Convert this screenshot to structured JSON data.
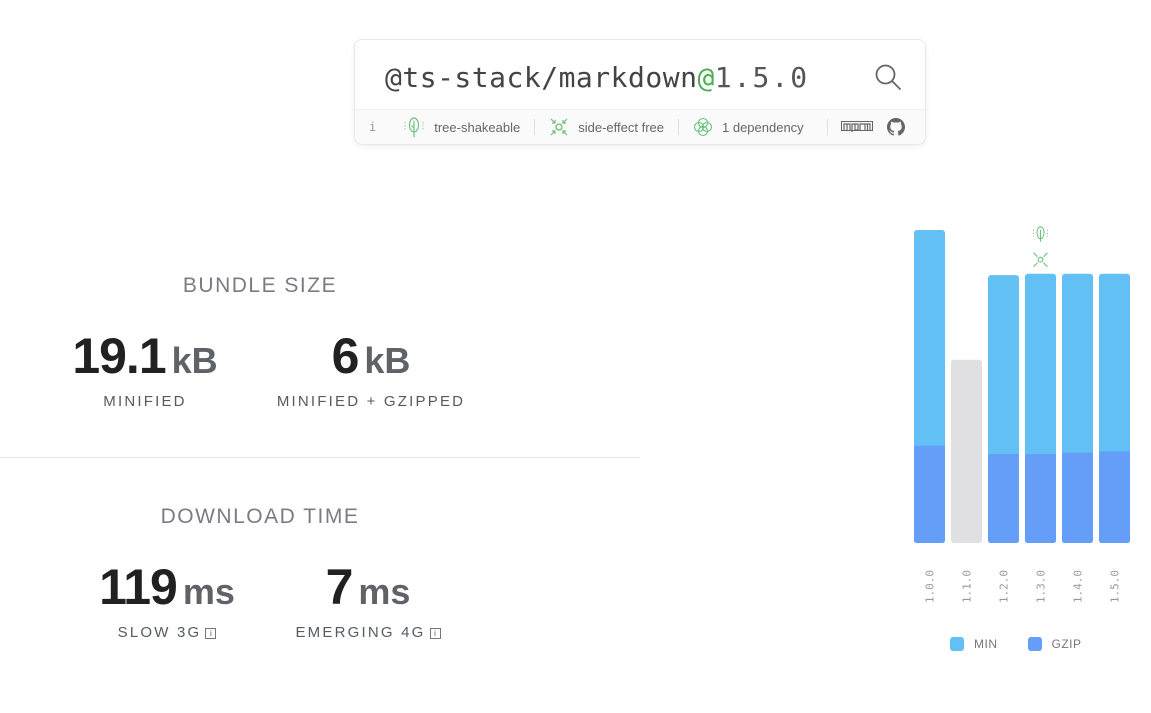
{
  "search": {
    "package_name": "ts-stack/markdown",
    "version": "1.5.0"
  },
  "meta": {
    "info_icon": "i",
    "tree_shakeable": "tree-shakeable",
    "side_effect_free": "side-effect free",
    "dependencies": "1 dependency"
  },
  "bundle_size": {
    "title": "BUNDLE SIZE",
    "minified": {
      "value": "19.1",
      "unit": "kB",
      "label": "MINIFIED"
    },
    "gzipped": {
      "value": "6",
      "unit": "kB",
      "label": "MINIFIED + GZIPPED"
    }
  },
  "download_time": {
    "title": "DOWNLOAD TIME",
    "slow3g": {
      "value": "119",
      "unit": "ms",
      "label": "SLOW 3G"
    },
    "emerging4g": {
      "value": "7",
      "unit": "ms",
      "label": "EMERGING 4G"
    }
  },
  "colors": {
    "min": "#62c0f5",
    "gzip": "#649ef8",
    "unavailable": "#e0e0e3",
    "accent": "#4caf50"
  },
  "chart_data": {
    "type": "bar",
    "categories": [
      "1.0.0",
      "1.1.0",
      "1.2.0",
      "1.3.0",
      "1.4.0",
      "1.5.0"
    ],
    "series": [
      {
        "name": "MIN",
        "values": [
          22.2,
          null,
          19.0,
          19.1,
          19.1,
          19.1
        ]
      },
      {
        "name": "GZIP",
        "values": [
          6.9,
          null,
          6.3,
          6.3,
          6.4,
          6.5
        ]
      }
    ],
    "unavailable": [
      false,
      true,
      false,
      false,
      false,
      false
    ],
    "unavailable_height": 13.0,
    "highlighted_version": "1.3.0",
    "legend": [
      "MIN",
      "GZIP"
    ],
    "legend_position": "bottom",
    "ylim": [
      0,
      22.2
    ]
  }
}
